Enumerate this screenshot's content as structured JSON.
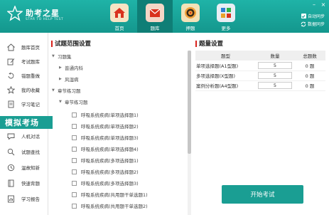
{
  "app": {
    "name": "助考之星",
    "subtitle": "STAR TO HELP TEST",
    "auto_sync_label": "自动同步",
    "data_sync_label": "数据同步"
  },
  "nav": [
    {
      "label": "首页",
      "icon": "home-icon",
      "active": false
    },
    {
      "label": "题库",
      "icon": "question-bank-icon",
      "active": true
    },
    {
      "label": "押题",
      "icon": "target-icon",
      "active": false
    },
    {
      "label": "更多",
      "icon": "more-apps-icon",
      "active": false
    }
  ],
  "sidebar": {
    "items": [
      {
        "label": "题库首页",
        "icon": "home-icon"
      },
      {
        "label": "考试题库",
        "icon": "edit-icon"
      },
      {
        "label": "错题重做",
        "icon": "redo-icon"
      },
      {
        "label": "我的收藏",
        "icon": "star-icon"
      },
      {
        "label": "学习笔记",
        "icon": "note-icon"
      }
    ],
    "highlight": "模拟考场",
    "items_after": [
      {
        "label": "人机对话",
        "icon": "chat-icon"
      },
      {
        "label": "试题查找",
        "icon": "search-icon"
      },
      {
        "label": "温故知新",
        "icon": "review-icon"
      },
      {
        "label": "快速背题",
        "icon": "book-icon"
      },
      {
        "label": "学习报告",
        "icon": "report-icon"
      }
    ]
  },
  "scope": {
    "title": "试题范围设置",
    "tree": [
      {
        "label": "习题集",
        "level": 0,
        "arrow": "down"
      },
      {
        "label": "普通内科",
        "level": 1,
        "arrow": "right"
      },
      {
        "label": "风湿病",
        "level": 1,
        "arrow": "right"
      },
      {
        "label": "章节练习题",
        "level": 0,
        "arrow": "down"
      },
      {
        "label": "章节练习题",
        "level": 1,
        "arrow": "down"
      },
      {
        "label": "呼吸系统疾病(单项选择题1)",
        "level": 2,
        "checkbox": true
      },
      {
        "label": "呼吸系统疾病(单项选择题2)",
        "level": 2,
        "checkbox": true
      },
      {
        "label": "呼吸系统疾病(单项选择题3)",
        "level": 2,
        "checkbox": true
      },
      {
        "label": "呼吸系统疾病(单项选择题4)",
        "level": 2,
        "checkbox": true
      },
      {
        "label": "呼吸系统疾病(多项选择题1)",
        "level": 2,
        "checkbox": true
      },
      {
        "label": "呼吸系统疾病(多项选择题2)",
        "level": 2,
        "checkbox": true
      },
      {
        "label": "呼吸系统疾病(多项选择题3)",
        "level": 2,
        "checkbox": true
      },
      {
        "label": "呼吸系统疾病(共用题干单选题1)",
        "level": 2,
        "checkbox": true
      },
      {
        "label": "呼吸系统疾病(共用题干单选题2)",
        "level": 2,
        "checkbox": true
      }
    ]
  },
  "quantity": {
    "title": "题量设置",
    "headers": [
      "题型",
      "数量",
      "总题数"
    ],
    "rows": [
      {
        "type": "单项选择题(A1型题)",
        "count": "5",
        "total": "0 题"
      },
      {
        "type": "多项选择题(X型题)",
        "count": "5",
        "total": "0 题"
      },
      {
        "type": "案例分析题(A4型题)",
        "count": "5",
        "total": "0 题"
      }
    ]
  },
  "start_button": "开始考试",
  "colors": {
    "header": "#1aa89d",
    "accent": "#1a9e93",
    "title_bar": "#d9221c"
  }
}
